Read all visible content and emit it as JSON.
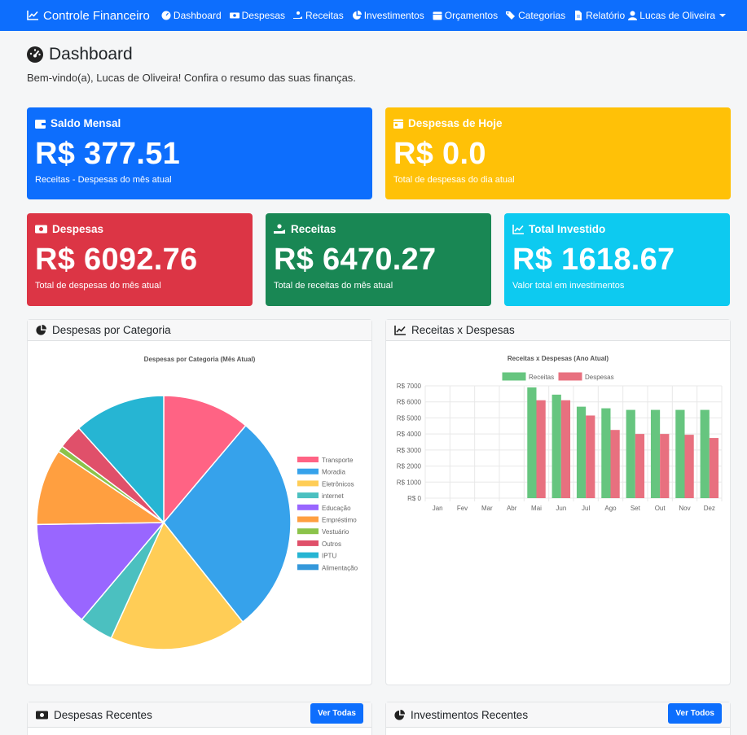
{
  "navbar": {
    "brand": "Controle Financeiro",
    "items": [
      {
        "label": "Dashboard",
        "icon": "gauge-icon"
      },
      {
        "label": "Despesas",
        "icon": "money-icon"
      },
      {
        "label": "Receitas",
        "icon": "hand-coin-icon"
      },
      {
        "label": "Investimentos",
        "icon": "pie-icon"
      },
      {
        "label": "Orçamentos",
        "icon": "calendar-icon"
      },
      {
        "label": "Categorias",
        "icon": "tags-icon"
      },
      {
        "label": "Relatório",
        "icon": "file-icon"
      }
    ],
    "user": "Lucas de Oliveira"
  },
  "header": {
    "title": "Dashboard",
    "subtitle": "Bem-vindo(a), Lucas de Oliveira! Confira o resumo das suas finanças."
  },
  "cards": {
    "saldo": {
      "title": "Saldo Mensal",
      "value": "R$ 377.51",
      "desc": "Receitas - Despesas do mês atual"
    },
    "hoje": {
      "title": "Despesas de Hoje",
      "value": "R$ 0.0",
      "desc": "Total de despesas do dia atual"
    },
    "despesas": {
      "title": "Despesas",
      "value": "R$ 6092.76",
      "desc": "Total de despesas do mês atual"
    },
    "receitas": {
      "title": "Receitas",
      "value": "R$ 6470.27",
      "desc": "Total de receitas do mês atual"
    },
    "investido": {
      "title": "Total Investido",
      "value": "R$ 1618.67",
      "desc": "Valor total em investimentos"
    }
  },
  "panels": {
    "categoria": {
      "title": "Despesas por Categoria"
    },
    "receitas_despesas": {
      "title": "Receitas x Despesas"
    },
    "despesas_recentes": {
      "title": "Despesas Recentes",
      "button": "Ver Todas"
    },
    "investimentos_recentes": {
      "title": "Investimentos Recentes",
      "button": "Ver Todos"
    }
  },
  "colors": {
    "primary": "#0d6efd",
    "warning": "#ffc107",
    "danger": "#dc3545",
    "success": "#198754",
    "info": "#0dcaf0"
  },
  "chart_data": [
    {
      "type": "pie",
      "title": "Despesas por Categoria (Mês Atual)",
      "legend_position": "right",
      "categories": [
        "Transporte",
        "Moradia",
        "Eletrônicos",
        "internet",
        "Educação",
        "Empréstimo",
        "Vestuário",
        "Outros",
        "IPTU",
        "Alimentação"
      ],
      "values": [
        11.5,
        29,
        18,
        4.5,
        14,
        10,
        0.8,
        3.2,
        12,
        0
      ],
      "colors": [
        "#ff6384",
        "#36a2eb",
        "#ffcd56",
        "#4bc0c0",
        "#9966ff",
        "#ff9f40",
        "#8bc34a",
        "#e0506a",
        "#26b5d3",
        "#3498db"
      ]
    },
    {
      "type": "bar",
      "title": "Receitas x Despesas (Ano Atual)",
      "legend_position": "top",
      "categories": [
        "Jan",
        "Fev",
        "Mar",
        "Abr",
        "Mai",
        "Jun",
        "Jul",
        "Ago",
        "Set",
        "Out",
        "Nov",
        "Dez"
      ],
      "series": [
        {
          "name": "Receitas",
          "color": "#66c57f",
          "values": [
            0,
            0,
            0,
            0,
            6900,
            6450,
            5700,
            5600,
            5500,
            5500,
            5500,
            5500
          ]
        },
        {
          "name": "Despesas",
          "color": "#e8707f",
          "values": [
            0,
            0,
            0,
            0,
            6100,
            6100,
            5150,
            4250,
            4000,
            4000,
            3950,
            3750
          ]
        }
      ],
      "y_ticks": [
        "R$ 0",
        "R$ 1000",
        "R$ 2000",
        "R$ 3000",
        "R$ 4000",
        "R$ 5000",
        "R$ 6000",
        "R$ 7000"
      ],
      "ylim": [
        0,
        7000
      ],
      "grid": true
    }
  ]
}
